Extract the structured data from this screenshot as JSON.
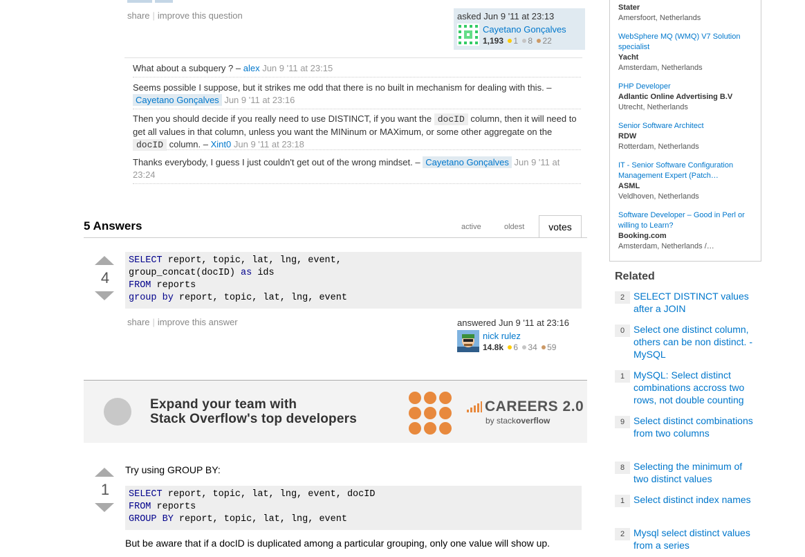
{
  "question": {
    "menu": {
      "share": "share",
      "improve": "improve this question"
    },
    "asked": {
      "label": "asked Jun 9 '11 at 23:13",
      "user": "Cayetano Gonçalves",
      "rep": "1,193",
      "gold": "1",
      "silver": "8",
      "bronze": "22"
    },
    "comments": [
      {
        "text": "What about a subquery ? – ",
        "user": "alex",
        "date": "Jun 9 '11 at 23:15"
      },
      {
        "text": "Seems possible I suppose, but it strikes me odd that there is no built in mechanism for dealing with this. – ",
        "user": "Cayetano Gonçalves",
        "date": "Jun 9 '11 at 23:16"
      },
      {
        "part1": "Then you should decide if you really need to use DISTINCT, if you want the ",
        "code1": "docID",
        "part2": " column, then it will need to get all values in that column, unless you want the MINinum or MAXimum, or some other aggregate on the ",
        "code2": "docID",
        "part3": " column. – ",
        "user": "Xint0",
        "date": "Jun 9 '11 at 23:18"
      },
      {
        "text": "Thanks everybody, I guess I just couldn't get out of the wrong mindset. – ",
        "user": "Cayetano Gonçalves",
        "date": "Jun 9 '11 at 23:24"
      }
    ]
  },
  "answers": {
    "count_label": "5 Answers",
    "tabs": {
      "active": "active",
      "oldest": "oldest",
      "votes": "votes"
    },
    "first": {
      "votes": "4",
      "code": [
        [
          {
            "k": "SELECT"
          },
          {
            "t": " report, topic, lat, lng, event,"
          }
        ],
        [
          {
            "t": "group_concat(docID) "
          },
          {
            "k": "as"
          },
          {
            "t": " ids"
          }
        ],
        [
          {
            "k": "FROM"
          },
          {
            "t": " reports"
          }
        ],
        [
          {
            "k": "group by"
          },
          {
            "t": " report, topic, lat, lng, event"
          }
        ]
      ],
      "menu": {
        "share": "share",
        "improve": "improve this answer"
      },
      "answered": {
        "label": "answered Jun 9 '11 at 23:16",
        "user": "nick rulez",
        "rep": "14.8k",
        "gold": "6",
        "silver": "34",
        "bronze": "59"
      }
    },
    "second": {
      "votes": "1",
      "intro": "Try using GROUP BY:",
      "code": [
        [
          {
            "k": "SELECT"
          },
          {
            "t": " report, topic, lat, lng, event, docID"
          }
        ],
        [
          {
            "k": "FROM"
          },
          {
            "t": " reports"
          }
        ],
        [
          {
            "k": "GROUP BY"
          },
          {
            "t": " report, topic, lat, lng, event"
          }
        ]
      ],
      "outro": "But be aware that if a docID is duplicated among a particular grouping, only one value will show up."
    }
  },
  "ad": {
    "line1": "Expand your team with",
    "line2": "Stack Overflow's top developers",
    "brand": "CAREERS 2.0",
    "brand_sub_prefix": "by stack",
    "brand_sub_bold": "overflow"
  },
  "jobs": [
    {
      "title": "",
      "company": "Stater",
      "location": "Amersfoort, Netherlands"
    },
    {
      "title": "WebSphere MQ (WMQ) V7 Solution specialist",
      "company": "Yacht",
      "location": "Amsterdam, Netherlands"
    },
    {
      "title": "PHP Developer",
      "company": "Adlantic Online Advertising B.V",
      "location": "Utrecht, Netherlands"
    },
    {
      "title": "Senior Software Architect",
      "company": "RDW",
      "location": "Rotterdam, Netherlands"
    },
    {
      "title": "IT - Senior Software Configuration Management Expert (Patch…",
      "company": "ASML",
      "location": "Veldhoven, Netherlands"
    },
    {
      "title": "Software Developer – Good in Perl or willing to Learn?",
      "company": "Booking.com",
      "location": "Amsterdam, Netherlands /…"
    }
  ],
  "related": {
    "title": "Related",
    "items": [
      {
        "count": "2",
        "title": "SELECT DISTINCT values after a JOIN"
      },
      {
        "count": "0",
        "title": "Select one distinct column, others can be non distinct. - MySQL"
      },
      {
        "count": "1",
        "title": "MySQL: Select distinct combinations accross two rows, not double counting"
      },
      {
        "count": "9",
        "title": "Select distinct combinations from two columns"
      },
      {
        "count": "8",
        "title": "Selecting the minimum of two distinct values"
      },
      {
        "count": "1",
        "title": "Select distinct index names"
      },
      {
        "count": "2",
        "title": "Mysql select distinct values from a series"
      }
    ]
  },
  "colors": {
    "link": "#0077cc",
    "owner_bg": "#e0eaf1",
    "ad_orange": "#e8893d"
  }
}
